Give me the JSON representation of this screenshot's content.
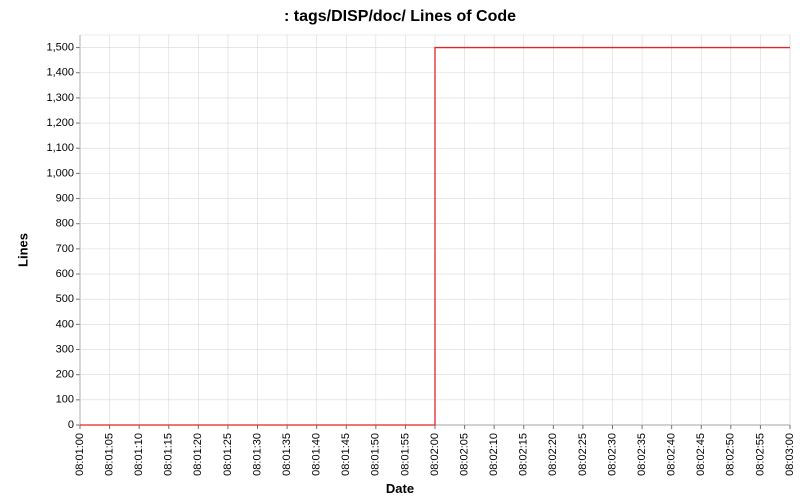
{
  "chart_data": {
    "type": "line",
    "title": ": tags/DISP/doc/ Lines of Code",
    "xlabel": "Date",
    "ylabel": "Lines",
    "x_categories": [
      "08:01:00",
      "08:01:05",
      "08:01:10",
      "08:01:15",
      "08:01:20",
      "08:01:25",
      "08:01:30",
      "08:01:35",
      "08:01:40",
      "08:01:45",
      "08:01:50",
      "08:01:55",
      "08:02:00",
      "08:02:05",
      "08:02:10",
      "08:02:15",
      "08:02:20",
      "08:02:25",
      "08:02:30",
      "08:02:35",
      "08:02:40",
      "08:02:45",
      "08:02:50",
      "08:02:55",
      "08:03:00"
    ],
    "y_ticks": [
      0,
      100,
      200,
      300,
      400,
      500,
      600,
      700,
      800,
      900,
      1000,
      1100,
      1200,
      1300,
      1400,
      1500
    ],
    "ylim": [
      0,
      1550
    ],
    "series": [
      {
        "name": "Lines of Code",
        "color": "#e22626",
        "points": [
          {
            "x": "08:01:00",
            "y": 0
          },
          {
            "x": "08:02:00",
            "y": 0
          },
          {
            "x": "08:02:00",
            "y": 1500
          },
          {
            "x": "08:03:00",
            "y": 1500
          }
        ]
      }
    ]
  }
}
